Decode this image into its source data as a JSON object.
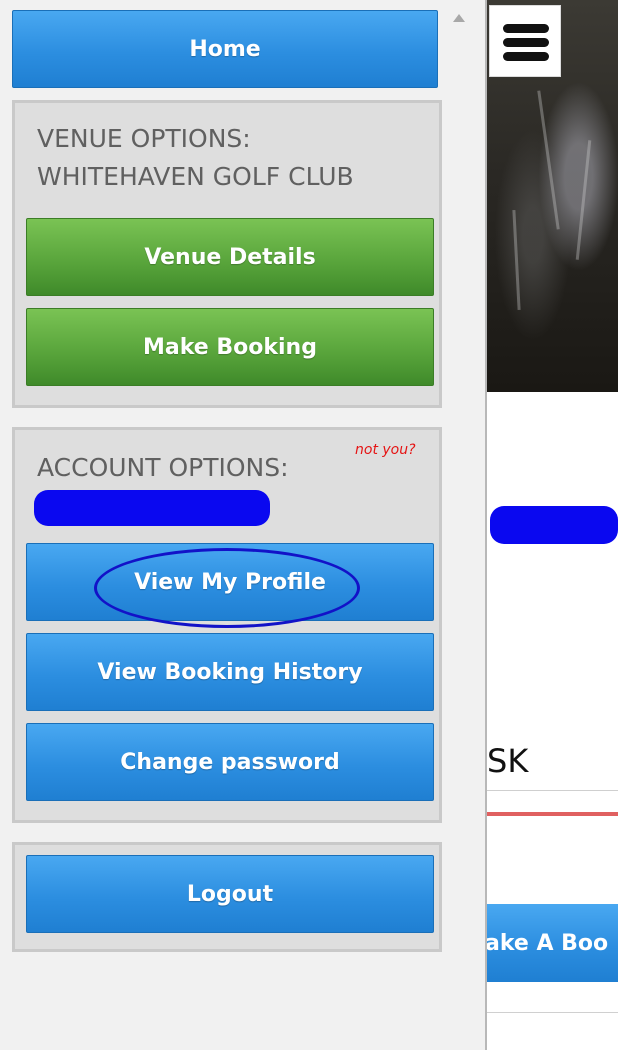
{
  "menu": {
    "home_label": "Home",
    "venue": {
      "heading_line1": "VENUE OPTIONS:",
      "heading_line2": "WHITEHAVEN GOLF CLUB",
      "details_label": "Venue Details",
      "booking_label": "Make Booking"
    },
    "account": {
      "heading": "ACCOUNT OPTIONS:",
      "not_you_label": "not you?",
      "profile_label": "View My Profile",
      "history_label": "View Booking History",
      "password_label": "Change password"
    },
    "logout_label": "Logout"
  },
  "background_page": {
    "menu_icon": "hamburger-icon",
    "field_text": "SK",
    "cta_label": "ake A Boo"
  },
  "colors": {
    "primary_blue": "#2c8ee0",
    "venue_green": "#57a33a",
    "not_you_red": "#e51414",
    "annotation_blue": "#1212c8"
  }
}
